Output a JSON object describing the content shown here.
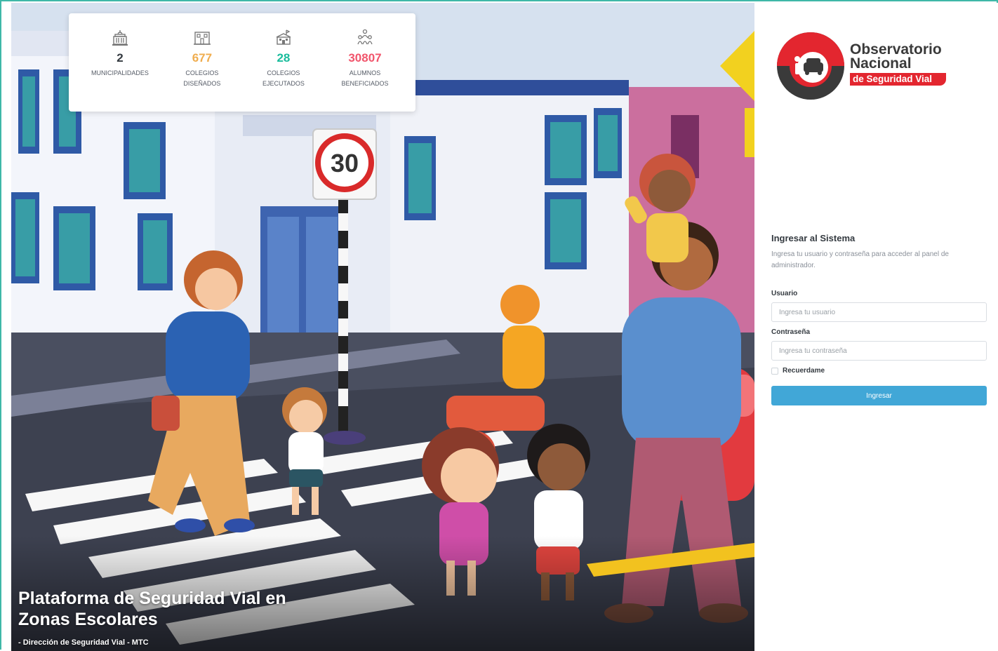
{
  "colors": {
    "accent_teal": "#3fb8a8",
    "button_blue": "#41a7d7",
    "logo_red": "#e3262f",
    "stat_dark": "#343a40",
    "stat_orange": "#f0ad4e",
    "stat_teal": "#1abc9c",
    "stat_red": "#f1556c"
  },
  "stats": [
    {
      "icon": "municipality-building-icon",
      "value": "2",
      "label": "MUNICIPALIDADES",
      "color": "#343a40"
    },
    {
      "icon": "school-design-icon",
      "value": "677",
      "label": "COLEGIOS DISEÑADOS",
      "color": "#f0ad4e"
    },
    {
      "icon": "school-built-icon",
      "value": "28",
      "label": "COLEGIOS EJECUTADOS",
      "color": "#1abc9c"
    },
    {
      "icon": "students-icon",
      "value": "30807",
      "label": "ALUMNOS BENEFICIADOS",
      "color": "#f1556c"
    }
  ],
  "hero": {
    "title": "Plataforma de Seguridad Vial en Zonas Escolares",
    "subtitle": "- Dirección de Seguridad Vial - MTC",
    "speed_sign": "30"
  },
  "logo": {
    "line1": "Observatorio",
    "line2": "Nacional",
    "line3": "de Seguridad Vial"
  },
  "login": {
    "title": "Ingresar al Sistema",
    "description": "Ingresa tu usuario y contraseña para acceder al panel de administrador.",
    "username_label": "Usuario",
    "username_placeholder": "Ingresa tu usuario",
    "username_value": "",
    "password_label": "Contraseña",
    "password_placeholder": "Ingresa tu contraseña",
    "password_value": "",
    "remember_label": "Recuerdame",
    "submit_label": "Ingresar"
  }
}
